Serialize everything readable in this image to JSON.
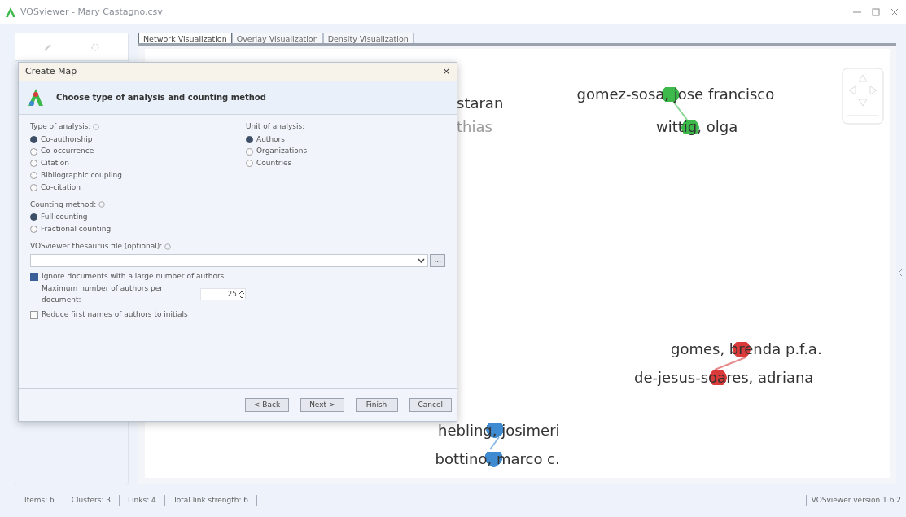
{
  "window": {
    "title": "VOSviewer - Mary Castagno.csv"
  },
  "tabs": [
    {
      "label": "Network Visualization",
      "selected": true
    },
    {
      "label": "Overlay Visualization",
      "selected": false
    },
    {
      "label": "Density Visualization",
      "selected": false
    }
  ],
  "network": {
    "nodes": [
      {
        "label": "staran",
        "dimmed": false
      },
      {
        "label": "thias",
        "dimmed": true
      },
      {
        "label": "gomez-sosa, jose francisco",
        "color": "#3cb94a",
        "dimmed": false
      },
      {
        "label": "wittig, olga",
        "color": "#3cb94a",
        "dimmed": false
      },
      {
        "label": "gomes, brenda p.f.a.",
        "color": "#d93a3a",
        "dimmed": false
      },
      {
        "label": "de-jesus-soares, adriana",
        "color": "#d93a3a",
        "dimmed": false
      },
      {
        "label": "hebling, josimeri",
        "color": "#3f8bd1",
        "dimmed": false
      },
      {
        "label": "bottino, marco c.",
        "color": "#3f8bd1",
        "dimmed": false
      }
    ]
  },
  "dialog": {
    "title": "Create Map",
    "close": "×",
    "heading": "Choose type of analysis and counting method",
    "type_of_analysis": {
      "label": "Type of analysis:",
      "options": [
        {
          "label": "Co-authorship",
          "selected": true
        },
        {
          "label": "Co-occurrence",
          "selected": false
        },
        {
          "label": "Citation",
          "selected": false
        },
        {
          "label": "Bibliographic coupling",
          "selected": false
        },
        {
          "label": "Co-citation",
          "selected": false
        }
      ]
    },
    "unit_of_analysis": {
      "label": "Unit of analysis:",
      "options": [
        {
          "label": "Authors",
          "selected": true
        },
        {
          "label": "Organizations",
          "selected": false
        },
        {
          "label": "Countries",
          "selected": false
        }
      ]
    },
    "counting_method": {
      "label": "Counting method:",
      "options": [
        {
          "label": "Full counting",
          "selected": true
        },
        {
          "label": "Fractional counting",
          "selected": false
        }
      ]
    },
    "thesaurus": {
      "label": "VOSviewer thesaurus file (optional):",
      "browse": "..."
    },
    "ignore_large": {
      "label": "Ignore documents with a large number of authors",
      "checked": true
    },
    "max_authors": {
      "label": "Maximum number of authors per document:",
      "value": "25"
    },
    "reduce_names": {
      "label": "Reduce first names of authors to initials",
      "checked": false
    },
    "buttons": [
      "< Back",
      "Next >",
      "Finish",
      "Cancel"
    ]
  },
  "status_bar": {
    "items": [
      "Items: 6",
      "Clusters: 3",
      "Links: 4",
      "Total link strength: 6"
    ],
    "version": "VOSviewer version 1.6.2"
  }
}
